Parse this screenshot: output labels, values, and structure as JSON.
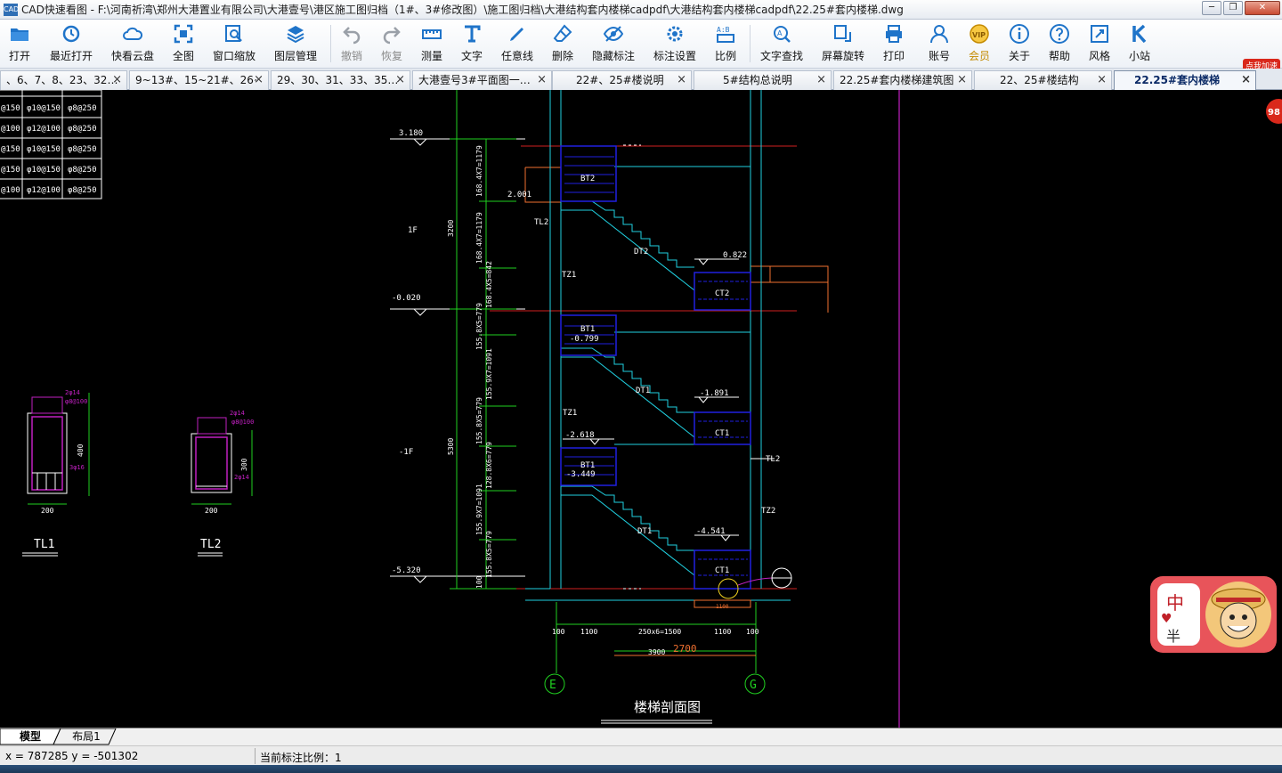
{
  "window": {
    "app_icon_text": "CAD",
    "title": "CAD快速看图 - F:\\河南祈湾\\郑州大港置业有限公司\\大港壹号\\港区施工图归档（1#、3#修改图）\\施工图归档\\大港结构套内楼梯cadpdf\\大港结构套内楼梯cadpdf\\22.25#套内楼梯.dwg",
    "minimize": "─",
    "restore": "❐",
    "close": "✕"
  },
  "toolbar": {
    "open": "打开",
    "recent": "最近打开",
    "cloud": "快看云盘",
    "fit_all": "全图",
    "window_zoom": "窗口缩放",
    "layers": "图层管理",
    "undo": "撤销",
    "redo": "恢复",
    "measure": "测量",
    "text": "文字",
    "freeline": "任意线",
    "erase": "删除",
    "hide_annot": "隐藏标注",
    "annot_settings": "标注设置",
    "ratio": "比例",
    "text_search": "文字查找",
    "rotate": "屏幕旋转",
    "print": "打印",
    "account": "账号",
    "member": "会员",
    "about": "关于",
    "help": "帮助",
    "style": "风格",
    "mini_site": "小站",
    "promo": "点我加速"
  },
  "tabs": [
    {
      "label": "、6、7、8、23、32…"
    },
    {
      "label": "9~13#、15~21#、26~2…"
    },
    {
      "label": "29、30、31、33、35…"
    },
    {
      "label": "大港壹号3#平面图一…"
    },
    {
      "label": "22#、25#楼说明"
    },
    {
      "label": "5#结构总说明"
    },
    {
      "label": "22.25#套内楼梯建筑图"
    },
    {
      "label": "22、25#楼结构"
    },
    {
      "label": "22.25#套内楼梯"
    }
  ],
  "drawing": {
    "rebar_table": [
      [
        "@150",
        "φ10@150",
        "φ8@250"
      ],
      [
        "@100",
        "φ12@100",
        "φ8@250"
      ],
      [
        "@150",
        "φ10@150",
        "φ8@250"
      ],
      [
        "@150",
        "φ10@150",
        "φ8@250"
      ],
      [
        "@100",
        "φ12@100",
        "φ8@250"
      ]
    ],
    "elev_top": "3.180",
    "elev_mid": "-0.020",
    "elev_bot": "-5.320",
    "floor_1f": "1F",
    "floor_neg1f": "-1F",
    "dim_3200": "3200",
    "dim_5300": "5300",
    "seg_a": "168.4X7=1179",
    "seg_b": "168.4X7=1179",
    "seg_c": "168.4X5=842",
    "seg_d": "155.8X5=779",
    "seg_e": "155.9X7=1091",
    "seg_f": "155.8X5=779",
    "seg_g": "128.8X6=779",
    "seg_h": "155.9X7=1091",
    "seg_i": "155.8X5=779",
    "seg_j": "100",
    "bt2": "BT2",
    "tl2_a": "TL2",
    "elev_2001": "2.001",
    "dt2": "DT2",
    "elev_0822": "0.822",
    "tz1_a": "TZ1",
    "ct2": "CT2",
    "bt1_a": "BT1",
    "elev_m0799": "-0.799",
    "dt1_a": "DT1",
    "elev_m1891": "-1.891",
    "tz1_b": "TZ1",
    "elev_m2618": "-2.618",
    "ct1_a": "CT1",
    "tl2_b": "TL2",
    "bt1_b": "BT1",
    "elev_m3449": "-3.449",
    "dt1_b": "DT1",
    "elev_m4541": "-4.541",
    "tz2": "TZ2",
    "ct1_b": "CT1",
    "dim_100a": "100",
    "dim_1100a": "1100",
    "dim_250x6": "250x6=1500",
    "dim_1100b": "1100",
    "dim_100b": "100",
    "dim_3900": "3900",
    "dim_2700": "2700",
    "dim_1100c": "1100",
    "axis_e": "E",
    "axis_g": "G",
    "section_title": "楼梯剖面图",
    "tl1_top": "2φ14",
    "tl1_stir": "φ8@100",
    "tl1_bot": "3φ16",
    "tl1_h": "400",
    "tl1_w": "200",
    "tl1_name": "TL1",
    "tl2_top": "2φ14",
    "tl2_stir": "φ8@100",
    "tl2_bot": "2φ14",
    "tl2_h": "300",
    "tl2_w": "200",
    "tl2_name": "TL2"
  },
  "layout_tabs": {
    "model": "模型",
    "layout1": "布局1"
  },
  "status": {
    "coords": "x = 787285  y = -501302",
    "scale": "当前标注比例：1"
  },
  "badge_number": "98",
  "helper": {
    "ime_char": "中",
    "ime_half": "半"
  }
}
